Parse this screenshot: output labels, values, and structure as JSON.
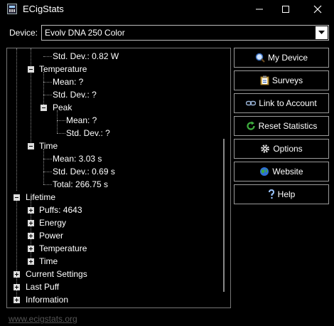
{
  "window": {
    "title": "ECigStats"
  },
  "device": {
    "label": "Device:",
    "value": "Evolv DNA 250 Color"
  },
  "tree": {
    "items": [
      {
        "text": "Std. Dev.: 0.82 W"
      },
      {
        "text": "Temperature"
      },
      {
        "text": "Mean: ?"
      },
      {
        "text": "Std. Dev.: ?"
      },
      {
        "text": "Peak"
      },
      {
        "text": "Mean: ?"
      },
      {
        "text": "Std. Dev.: ?"
      },
      {
        "text": "Time"
      },
      {
        "text": "Mean: 3.03 s"
      },
      {
        "text": "Std. Dev.: 0.69 s"
      },
      {
        "text": "Total: 266.75 s"
      },
      {
        "text": "Lifetime"
      },
      {
        "text": "Puffs: 4643"
      },
      {
        "text": "Energy"
      },
      {
        "text": "Power"
      },
      {
        "text": "Temperature"
      },
      {
        "text": "Time"
      },
      {
        "text": "Current Settings"
      },
      {
        "text": "Last Puff"
      },
      {
        "text": "Information"
      }
    ]
  },
  "buttons": {
    "my_device": "My Device",
    "surveys": "Surveys",
    "link_account": "Link to Account",
    "reset_stats": "Reset Statistics",
    "options": "Options",
    "website": "Website",
    "help": "Help"
  },
  "footer": {
    "link": "www.ecigstats.org"
  },
  "colors": {
    "background": "#000000",
    "text": "#ffffff",
    "border": "#9a9a9a",
    "link": "#555555"
  }
}
